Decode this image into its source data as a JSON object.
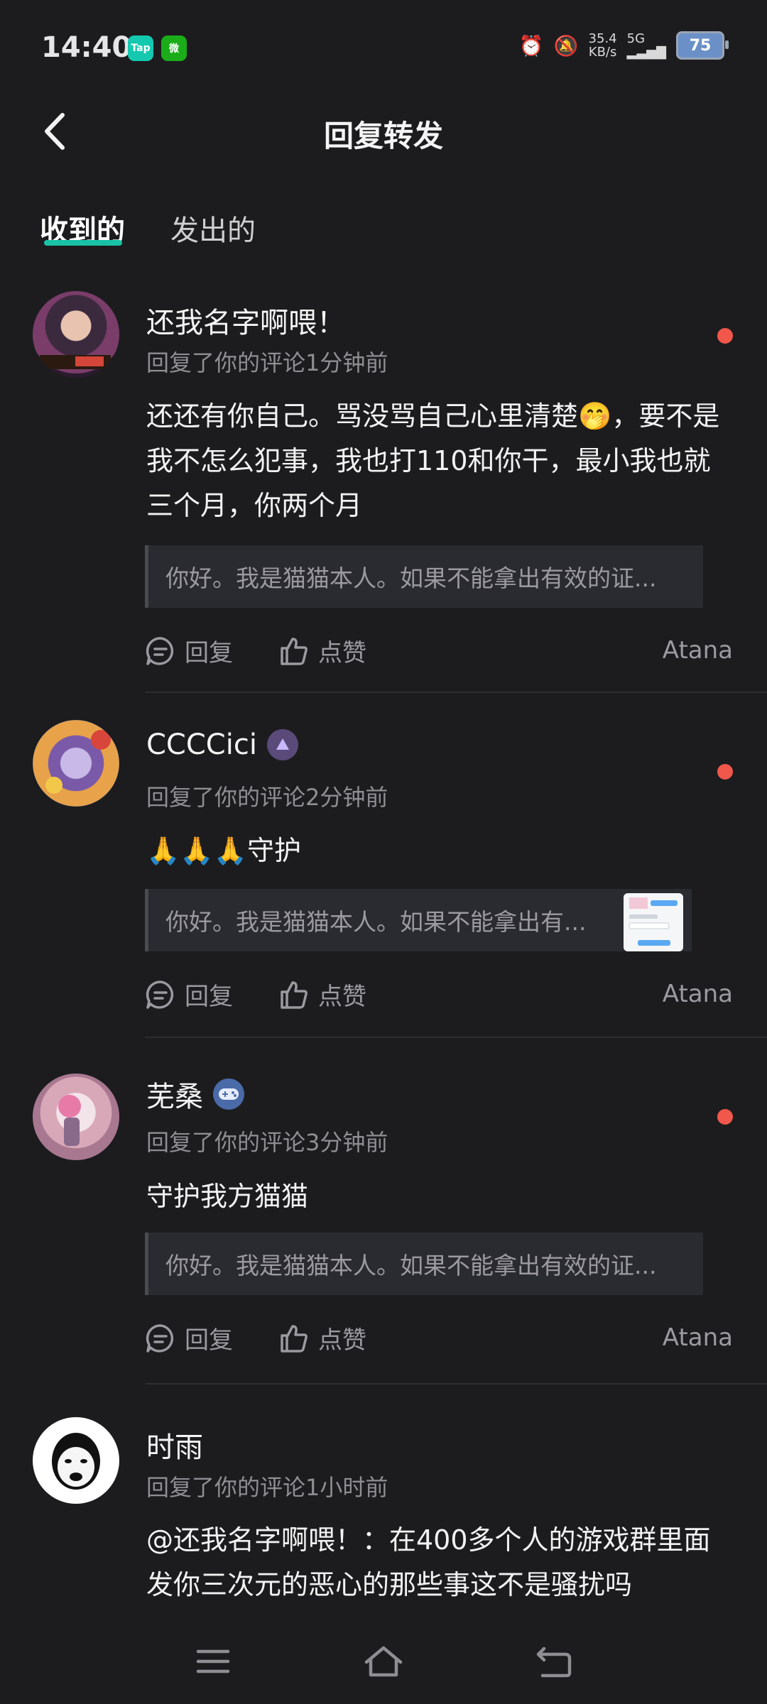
{
  "status_bar": {
    "time": "14:40",
    "app_badges": [
      "Tap",
      "微"
    ],
    "net_speed_value": "35.4",
    "net_speed_unit": "KB/s",
    "network": "5G",
    "battery": "75"
  },
  "header": {
    "title": "回复转发"
  },
  "tabs": [
    {
      "label": "收到的",
      "active": true
    },
    {
      "label": "发出的",
      "active": false
    }
  ],
  "actions": {
    "reply_label": "回复",
    "like_label": "点赞"
  },
  "replies": [
    {
      "username": "还我名字啊喂！",
      "meta": "回复了你的评论1分钟前",
      "content": "还还有你自己。骂没骂自己心里清楚🤭，要不是我不怎么犯事，我也打110和你干，最小我也就三个月，你两个月",
      "quote": "你好。我是猫猫本人。如果不能拿出有效的证...",
      "owner": "Atana",
      "unread": true
    },
    {
      "username": "CCCCici",
      "meta": "回复了你的评论2分钟前",
      "content": "🙏🙏🙏守护",
      "quote": "你好。我是猫猫本人。如果不能拿出有...",
      "owner": "Atana",
      "unread": true
    },
    {
      "username": "芜桑",
      "meta": "回复了你的评论3分钟前",
      "content": "守护我方猫猫",
      "quote": "你好。我是猫猫本人。如果不能拿出有效的证...",
      "owner": "Atana",
      "unread": true
    },
    {
      "username": "时雨",
      "meta": "回复了你的评论1小时前",
      "content": "@还我名字啊喂！：在400多个人的游戏群里面发你三次元的恶心的那些事这不是骚扰吗",
      "unread": false
    }
  ],
  "colors": {
    "background": "#1c1c1e",
    "accent": "#19c2a6",
    "unread_dot": "#f2574c",
    "secondary_text": "#8e8e93"
  },
  "icons": {
    "back": "chevron-left-icon",
    "reply": "comment-bubble-icon",
    "like": "thumbs-up-icon",
    "nav": [
      "menu-icon",
      "home-icon",
      "back-arrow-icon"
    ]
  }
}
